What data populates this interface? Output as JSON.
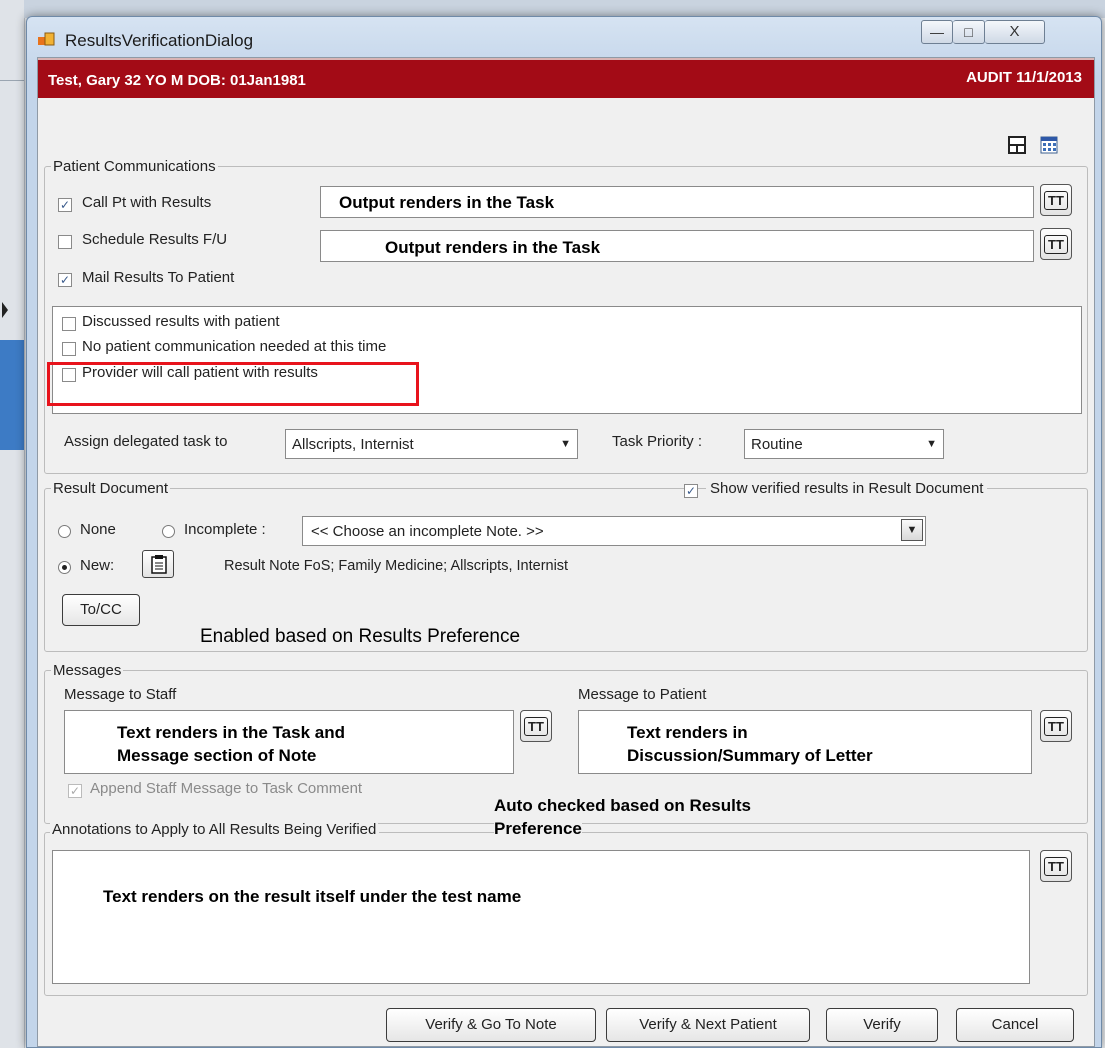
{
  "window": {
    "title": "ResultsVerificationDialog",
    "minimize": "—",
    "maximize": "□",
    "close": "X"
  },
  "header": {
    "patient": "Test, Gary  32 YO  M DOB: 01Jan1981",
    "audit": "AUDIT  11/1/2013"
  },
  "patient_comms": {
    "legend": "Patient Communications",
    "call_pt": {
      "label": "Call Pt with Results",
      "checked": true,
      "output": "Output renders in the Task"
    },
    "schedule": {
      "label": "Schedule Results F/U",
      "checked": false,
      "output": "Output renders in the Task"
    },
    "mail": {
      "label": "Mail Results To Patient",
      "checked": true
    },
    "options": [
      {
        "label": "Discussed results with patient",
        "checked": false
      },
      {
        "label": "No patient communication needed at this time",
        "checked": false
      },
      {
        "label": "Provider will call patient with results",
        "checked": false
      }
    ],
    "assign_label": "Assign delegated task to",
    "assign_value": "Allscripts, Internist",
    "priority_label": "Task Priority :",
    "priority_value": "Routine"
  },
  "tt_label": "TT",
  "result_doc": {
    "legend": "Result Document",
    "show_verified_label": "Show verified results in Result Document",
    "show_verified_checked": true,
    "none_label": "None",
    "incomplete_label": "Incomplete :",
    "incomplete_placeholder": "<< Choose an incomplete Note. >>",
    "new_label": "New:",
    "new_note": "Result Note FoS; Family Medicine; Allscripts, Internist",
    "tocc_label": "To/CC",
    "selected": "New"
  },
  "messages": {
    "legend": "Messages",
    "staff_label": "Message to Staff",
    "patient_label": "Message to Patient",
    "staff_text_1": "Text renders in the Task and",
    "staff_text_2": "Message section of Note",
    "patient_text_1": "Text renders in",
    "patient_text_2": "Discussion/Summary of Letter",
    "append_label": "Append Staff Message to Task Comment",
    "append_checked": true
  },
  "annotations": {
    "legend": "Annotations to Apply to All Results Being Verified",
    "text": "Text renders on the result itself under the test name"
  },
  "callouts": {
    "enabled": "Enabled based on Results Preference",
    "auto_checked_1": "Auto checked based on Results",
    "auto_checked_2": "Preference"
  },
  "buttons": {
    "verify_note": "Verify & Go To Note",
    "verify_next": "Verify &  Next Patient",
    "verify": "Verify",
    "cancel": "Cancel"
  },
  "colors": {
    "header_red": "#a30b16",
    "highlight_red": "#e8131c"
  }
}
